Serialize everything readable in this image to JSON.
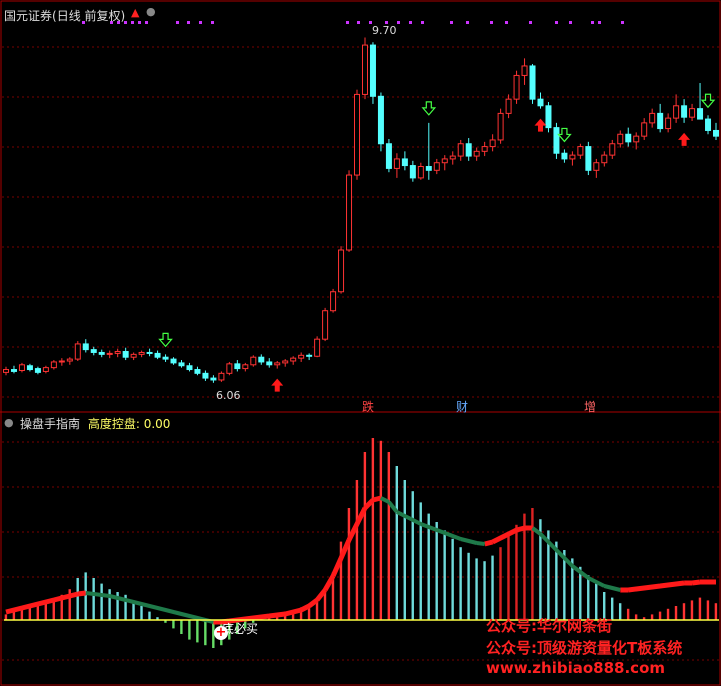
{
  "top_pane": {
    "title": "国元证券",
    "period": "(日线 前复权)",
    "high_label": "9.70",
    "low_label": "6.06",
    "event_tags": [
      {
        "text": "跌",
        "color": "#ff4444"
      },
      {
        "text": "财",
        "color": "#66aaff"
      },
      {
        "text": "增",
        "color": "#ff6666"
      }
    ]
  },
  "bottom_pane": {
    "indicator_name": "操盘手指南",
    "series_label": "高度控盘:",
    "series_value": "0.00",
    "bottom_marker": "底必买"
  },
  "watermark": {
    "line1": "公众号:华尔网条街",
    "line2": "公众号:顶级游资量化T板系统",
    "line3": "www.zhibiao888.com"
  },
  "colors": {
    "up": "#ff3333",
    "down": "#54ffff",
    "grid": "#7a0000",
    "ribbon_up": "#ff1a1a",
    "ribbon_down": "#1f7a4a",
    "baseline": "#ffff44",
    "signal_dots": "#cc33ff"
  },
  "chart_data": [
    {
      "type": "candlestick",
      "title": "国元证券 (日线 前复权)",
      "annotations": [
        {
          "text": "9.70",
          "kind": "high"
        },
        {
          "text": "6.06",
          "kind": "low"
        }
      ],
      "candles": [
        [
          6.17,
          6.23,
          6.14,
          6.2
        ],
        [
          6.2,
          6.24,
          6.16,
          6.18
        ],
        [
          6.19,
          6.27,
          6.17,
          6.25
        ],
        [
          6.24,
          6.26,
          6.18,
          6.2
        ],
        [
          6.21,
          6.23,
          6.15,
          6.17
        ],
        [
          6.18,
          6.24,
          6.16,
          6.22
        ],
        [
          6.22,
          6.3,
          6.2,
          6.28
        ],
        [
          6.28,
          6.32,
          6.24,
          6.29
        ],
        [
          6.29,
          6.33,
          6.25,
          6.31
        ],
        [
          6.31,
          6.5,
          6.29,
          6.47
        ],
        [
          6.47,
          6.52,
          6.38,
          6.41
        ],
        [
          6.41,
          6.44,
          6.35,
          6.38
        ],
        [
          6.38,
          6.41,
          6.33,
          6.36
        ],
        [
          6.36,
          6.4,
          6.32,
          6.37
        ],
        [
          6.37,
          6.42,
          6.33,
          6.39
        ],
        [
          6.39,
          6.43,
          6.3,
          6.33
        ],
        [
          6.33,
          6.38,
          6.3,
          6.36
        ],
        [
          6.36,
          6.4,
          6.33,
          6.38
        ],
        [
          6.38,
          6.42,
          6.34,
          6.37
        ],
        [
          6.37,
          6.4,
          6.31,
          6.33
        ],
        [
          6.33,
          6.36,
          6.28,
          6.31
        ],
        [
          6.31,
          6.33,
          6.25,
          6.27
        ],
        [
          6.27,
          6.3,
          6.22,
          6.24
        ],
        [
          6.24,
          6.27,
          6.18,
          6.2
        ],
        [
          6.2,
          6.23,
          6.14,
          6.16
        ],
        [
          6.16,
          6.19,
          6.08,
          6.11
        ],
        [
          6.11,
          6.14,
          6.06,
          6.09
        ],
        [
          6.09,
          6.18,
          6.07,
          6.16
        ],
        [
          6.16,
          6.28,
          6.14,
          6.26
        ],
        [
          6.26,
          6.3,
          6.18,
          6.21
        ],
        [
          6.21,
          6.27,
          6.18,
          6.25
        ],
        [
          6.25,
          6.35,
          6.23,
          6.33
        ],
        [
          6.33,
          6.36,
          6.25,
          6.28
        ],
        [
          6.28,
          6.32,
          6.22,
          6.25
        ],
        [
          6.25,
          6.29,
          6.21,
          6.27
        ],
        [
          6.27,
          6.31,
          6.23,
          6.29
        ],
        [
          6.29,
          6.34,
          6.25,
          6.32
        ],
        [
          6.32,
          6.38,
          6.28,
          6.35
        ],
        [
          6.35,
          6.37,
          6.3,
          6.34
        ],
        [
          6.34,
          6.55,
          6.33,
          6.52
        ],
        [
          6.52,
          6.85,
          6.5,
          6.82
        ],
        [
          6.82,
          7.05,
          6.8,
          7.02
        ],
        [
          7.02,
          7.5,
          7.0,
          7.46
        ],
        [
          7.46,
          8.3,
          7.44,
          8.25
        ],
        [
          8.25,
          9.15,
          8.2,
          9.1
        ],
        [
          9.1,
          9.7,
          9.05,
          9.62
        ],
        [
          9.62,
          9.65,
          9.0,
          9.08
        ],
        [
          9.08,
          9.12,
          8.5,
          8.58
        ],
        [
          8.58,
          8.63,
          8.28,
          8.32
        ],
        [
          8.32,
          8.48,
          8.22,
          8.42
        ],
        [
          8.42,
          8.5,
          8.3,
          8.35
        ],
        [
          8.35,
          8.4,
          8.18,
          8.22
        ],
        [
          8.22,
          8.38,
          8.2,
          8.34
        ],
        [
          8.34,
          8.8,
          8.2,
          8.3
        ],
        [
          8.3,
          8.42,
          8.26,
          8.38
        ],
        [
          8.38,
          8.46,
          8.3,
          8.42
        ],
        [
          8.42,
          8.5,
          8.36,
          8.45
        ],
        [
          8.45,
          8.62,
          8.4,
          8.58
        ],
        [
          8.58,
          8.64,
          8.4,
          8.45
        ],
        [
          8.45,
          8.54,
          8.4,
          8.5
        ],
        [
          8.5,
          8.6,
          8.45,
          8.55
        ],
        [
          8.55,
          8.68,
          8.5,
          8.62
        ],
        [
          8.62,
          8.95,
          8.58,
          8.9
        ],
        [
          8.9,
          9.1,
          8.85,
          9.05
        ],
        [
          9.05,
          9.35,
          9.0,
          9.3
        ],
        [
          9.3,
          9.48,
          9.2,
          9.4
        ],
        [
          9.4,
          9.42,
          9.0,
          9.05
        ],
        [
          9.05,
          9.12,
          8.95,
          8.98
        ],
        [
          8.98,
          9.02,
          8.7,
          8.75
        ],
        [
          8.75,
          8.8,
          8.42,
          8.48
        ],
        [
          8.48,
          8.52,
          8.38,
          8.42
        ],
        [
          8.42,
          8.5,
          8.35,
          8.46
        ],
        [
          8.46,
          8.58,
          8.42,
          8.55
        ],
        [
          8.55,
          8.6,
          8.25,
          8.3
        ],
        [
          8.3,
          8.42,
          8.22,
          8.38
        ],
        [
          8.38,
          8.5,
          8.34,
          8.46
        ],
        [
          8.46,
          8.62,
          8.42,
          8.58
        ],
        [
          8.58,
          8.72,
          8.54,
          8.68
        ],
        [
          8.68,
          8.75,
          8.55,
          8.6
        ],
        [
          8.6,
          8.7,
          8.52,
          8.66
        ],
        [
          8.66,
          8.85,
          8.62,
          8.8
        ],
        [
          8.8,
          8.95,
          8.75,
          8.9
        ],
        [
          8.9,
          9.0,
          8.7,
          8.74
        ],
        [
          8.74,
          8.9,
          8.7,
          8.85
        ],
        [
          8.85,
          9.1,
          8.8,
          8.98
        ],
        [
          8.98,
          9.05,
          8.8,
          8.86
        ],
        [
          8.86,
          9.0,
          8.82,
          8.95
        ],
        [
          8.95,
          9.22,
          8.9,
          8.84
        ],
        [
          8.84,
          8.88,
          8.68,
          8.72
        ],
        [
          8.72,
          8.8,
          8.62,
          8.66
        ]
      ],
      "signals": [
        {
          "i": 20,
          "type": "sell_arrow"
        },
        {
          "i": 34,
          "type": "buy_arrow"
        },
        {
          "i": 53,
          "type": "sell_arrow"
        },
        {
          "i": 67,
          "type": "buy_arrow"
        },
        {
          "i": 70,
          "type": "sell_arrow"
        },
        {
          "i": 85,
          "type": "buy_arrow"
        },
        {
          "i": 88,
          "type": "sell_arrow"
        }
      ]
    },
    {
      "type": "bar+area",
      "title": "操盘手指南",
      "series": [
        {
          "name": "高度控盘",
          "values": [
            0,
            0,
            0,
            0,
            0,
            0,
            0,
            0,
            0,
            0,
            0,
            0,
            0,
            0,
            0,
            0,
            0,
            0,
            0,
            0,
            0,
            0,
            0,
            0,
            0,
            0,
            0,
            0,
            0,
            0,
            0,
            0,
            0,
            0,
            0,
            0,
            0,
            0,
            0,
            0,
            0,
            0,
            0,
            0,
            0,
            0,
            0,
            0,
            0,
            0,
            0,
            0,
            0,
            0,
            0,
            0,
            0,
            0,
            0,
            0,
            0,
            0,
            0,
            0,
            0,
            0,
            0,
            0,
            0,
            0,
            0,
            0,
            0,
            0,
            0,
            0,
            0,
            0,
            0,
            0,
            0,
            0,
            0,
            0,
            0,
            0,
            0,
            0,
            0,
            0
          ]
        }
      ],
      "bars": [
        4,
        6,
        8,
        9,
        10,
        12,
        14,
        18,
        22,
        30,
        34,
        30,
        26,
        22,
        20,
        18,
        14,
        10,
        6,
        2,
        -2,
        -6,
        -10,
        -14,
        -16,
        -18,
        -20,
        -18,
        -14,
        -10,
        -6,
        -2,
        2,
        4,
        5,
        6,
        7,
        9,
        11,
        14,
        20,
        34,
        56,
        80,
        100,
        120,
        130,
        128,
        120,
        110,
        100,
        92,
        84,
        76,
        70,
        64,
        58,
        52,
        48,
        44,
        42,
        46,
        52,
        60,
        68,
        76,
        80,
        72,
        64,
        56,
        50,
        44,
        38,
        32,
        26,
        20,
        16,
        12,
        8,
        4,
        2,
        4,
        6,
        8,
        10,
        12,
        14,
        16,
        14,
        12
      ],
      "ribbon": [
        8,
        10,
        12,
        14,
        16,
        18,
        20,
        22,
        24,
        26,
        27,
        26,
        25,
        24,
        22,
        20,
        18,
        16,
        14,
        12,
        10,
        8,
        6,
        4,
        2,
        0,
        -2,
        -2,
        -1,
        0,
        1,
        2,
        3,
        4,
        5,
        6,
        8,
        10,
        14,
        20,
        30,
        44,
        62,
        80,
        96,
        112,
        120,
        122,
        118,
        108,
        104,
        100,
        96,
        93,
        90,
        87,
        84,
        81,
        79,
        77,
        76,
        78,
        82,
        86,
        90,
        92,
        92,
        86,
        78,
        70,
        62,
        54,
        48,
        42,
        38,
        34,
        32,
        30,
        30,
        31,
        32,
        33,
        34,
        35,
        36,
        37,
        37,
        38,
        38,
        38
      ]
    }
  ]
}
